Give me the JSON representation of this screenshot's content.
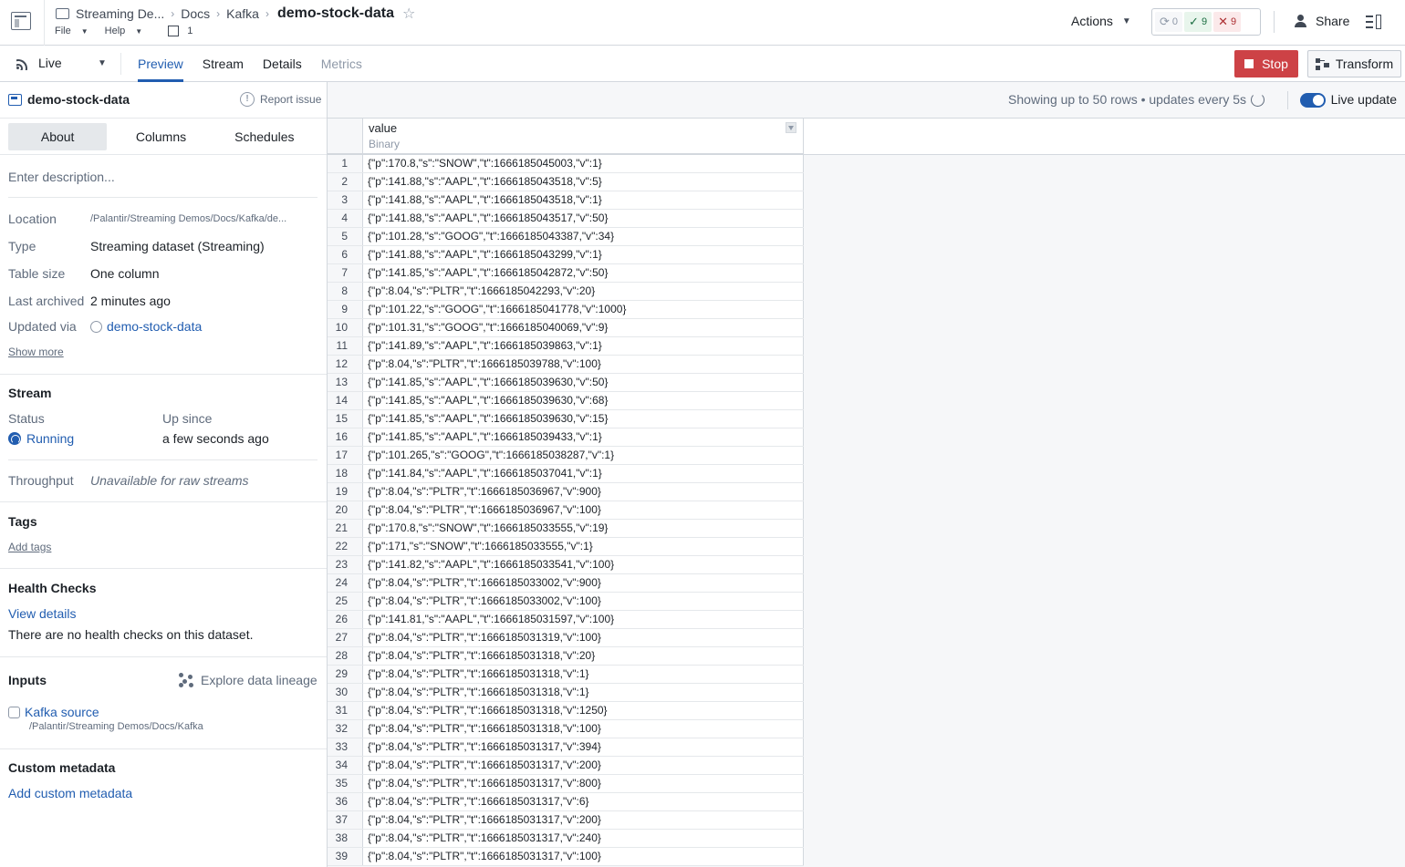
{
  "header": {
    "breadcrumbs": [
      "Streaming De...",
      "Docs",
      "Kafka"
    ],
    "title": "demo-stock-data",
    "menu": {
      "file": "File",
      "help": "Help",
      "branch_count": "1"
    },
    "actions_label": "Actions",
    "checks": {
      "pending": "0",
      "passed": "9",
      "failed": "9"
    },
    "share_label": "Share"
  },
  "toolbar": {
    "mode": "Live",
    "tabs": [
      {
        "label": "Preview",
        "state": "active"
      },
      {
        "label": "Stream",
        "state": "normal"
      },
      {
        "label": "Details",
        "state": "normal"
      },
      {
        "label": "Metrics",
        "state": "disabled"
      }
    ],
    "stop_label": "Stop",
    "transform_label": "Transform"
  },
  "sidebar": {
    "dataset_name": "demo-stock-data",
    "report_issue": "Report issue",
    "tabs": [
      "About",
      "Columns",
      "Schedules"
    ],
    "description_placeholder": "Enter description...",
    "properties": {
      "location_key": "Location",
      "location_val": "/Palantir/Streaming Demos/Docs/Kafka/de...",
      "type_key": "Type",
      "type_val": "Streaming dataset (Streaming)",
      "size_key": "Table size",
      "size_val": "One column",
      "archived_key": "Last archived",
      "archived_val": "2 minutes ago",
      "updated_key": "Updated via",
      "updated_val": "demo-stock-data"
    },
    "show_more": "Show more",
    "stream": {
      "heading": "Stream",
      "status_key": "Status",
      "status_val": "Running",
      "up_key": "Up since",
      "up_val": "a few seconds ago",
      "throughput_key": "Throughput",
      "throughput_val": "Unavailable for raw streams"
    },
    "tags": {
      "heading": "Tags",
      "add": "Add tags"
    },
    "health": {
      "heading": "Health Checks",
      "view": "View details",
      "note": "There are no health checks on this dataset."
    },
    "inputs": {
      "heading": "Inputs",
      "lineage": "Explore data lineage",
      "source_name": "Kafka source",
      "source_path": "/Palantir/Streaming Demos/Docs/Kafka"
    },
    "custom": {
      "heading": "Custom metadata",
      "add": "Add custom metadata"
    }
  },
  "preview": {
    "showing": "Showing up to 50 rows • updates every 5s",
    "live_update": "Live update",
    "column": {
      "name": "value",
      "type": "Binary"
    },
    "rows": [
      "{\"p\":170.8,\"s\":\"SNOW\",\"t\":1666185045003,\"v\":1}",
      "{\"p\":141.88,\"s\":\"AAPL\",\"t\":1666185043518,\"v\":5}",
      "{\"p\":141.88,\"s\":\"AAPL\",\"t\":1666185043518,\"v\":1}",
      "{\"p\":141.88,\"s\":\"AAPL\",\"t\":1666185043517,\"v\":50}",
      "{\"p\":101.28,\"s\":\"GOOG\",\"t\":1666185043387,\"v\":34}",
      "{\"p\":141.88,\"s\":\"AAPL\",\"t\":1666185043299,\"v\":1}",
      "{\"p\":141.85,\"s\":\"AAPL\",\"t\":1666185042872,\"v\":50}",
      "{\"p\":8.04,\"s\":\"PLTR\",\"t\":1666185042293,\"v\":20}",
      "{\"p\":101.22,\"s\":\"GOOG\",\"t\":1666185041778,\"v\":1000}",
      "{\"p\":101.31,\"s\":\"GOOG\",\"t\":1666185040069,\"v\":9}",
      "{\"p\":141.89,\"s\":\"AAPL\",\"t\":1666185039863,\"v\":1}",
      "{\"p\":8.04,\"s\":\"PLTR\",\"t\":1666185039788,\"v\":100}",
      "{\"p\":141.85,\"s\":\"AAPL\",\"t\":1666185039630,\"v\":50}",
      "{\"p\":141.85,\"s\":\"AAPL\",\"t\":1666185039630,\"v\":68}",
      "{\"p\":141.85,\"s\":\"AAPL\",\"t\":1666185039630,\"v\":15}",
      "{\"p\":141.85,\"s\":\"AAPL\",\"t\":1666185039433,\"v\":1}",
      "{\"p\":101.265,\"s\":\"GOOG\",\"t\":1666185038287,\"v\":1}",
      "{\"p\":141.84,\"s\":\"AAPL\",\"t\":1666185037041,\"v\":1}",
      "{\"p\":8.04,\"s\":\"PLTR\",\"t\":1666185036967,\"v\":900}",
      "{\"p\":8.04,\"s\":\"PLTR\",\"t\":1666185036967,\"v\":100}",
      "{\"p\":170.8,\"s\":\"SNOW\",\"t\":1666185033555,\"v\":19}",
      "{\"p\":171,\"s\":\"SNOW\",\"t\":1666185033555,\"v\":1}",
      "{\"p\":141.82,\"s\":\"AAPL\",\"t\":1666185033541,\"v\":100}",
      "{\"p\":8.04,\"s\":\"PLTR\",\"t\":1666185033002,\"v\":900}",
      "{\"p\":8.04,\"s\":\"PLTR\",\"t\":1666185033002,\"v\":100}",
      "{\"p\":141.81,\"s\":\"AAPL\",\"t\":1666185031597,\"v\":100}",
      "{\"p\":8.04,\"s\":\"PLTR\",\"t\":1666185031319,\"v\":100}",
      "{\"p\":8.04,\"s\":\"PLTR\",\"t\":1666185031318,\"v\":20}",
      "{\"p\":8.04,\"s\":\"PLTR\",\"t\":1666185031318,\"v\":1}",
      "{\"p\":8.04,\"s\":\"PLTR\",\"t\":1666185031318,\"v\":1}",
      "{\"p\":8.04,\"s\":\"PLTR\",\"t\":1666185031318,\"v\":1250}",
      "{\"p\":8.04,\"s\":\"PLTR\",\"t\":1666185031318,\"v\":100}",
      "{\"p\":8.04,\"s\":\"PLTR\",\"t\":1666185031317,\"v\":394}",
      "{\"p\":8.04,\"s\":\"PLTR\",\"t\":1666185031317,\"v\":200}",
      "{\"p\":8.04,\"s\":\"PLTR\",\"t\":1666185031317,\"v\":800}",
      "{\"p\":8.04,\"s\":\"PLTR\",\"t\":1666185031317,\"v\":6}",
      "{\"p\":8.04,\"s\":\"PLTR\",\"t\":1666185031317,\"v\":200}",
      "{\"p\":8.04,\"s\":\"PLTR\",\"t\":1666185031317,\"v\":240}",
      "{\"p\":8.04,\"s\":\"PLTR\",\"t\":1666185031317,\"v\":100}"
    ]
  },
  "colors": {
    "accent": "#215db0",
    "danger": "#cd4246",
    "success": "#1c6e42"
  }
}
